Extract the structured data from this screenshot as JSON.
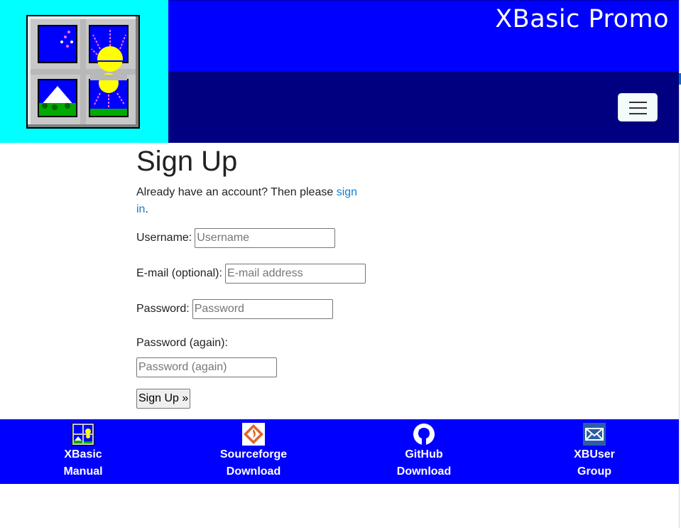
{
  "header": {
    "title": "XBasic Promo",
    "logo_icon": "xbasic-window-logo",
    "menu_icon": "hamburger-menu-icon"
  },
  "main": {
    "heading": "Sign Up",
    "intro_text": "Already have an account? Then please ",
    "signin_link": "sign in",
    "intro_end": ".",
    "username_label": "Username:",
    "username_placeholder": "Username",
    "username_value": "",
    "email_label": "E-mail (optional):",
    "email_placeholder": "E-mail address",
    "email_value": "",
    "password_label": "Password:",
    "password_placeholder": "Password",
    "password_value": "",
    "password2_label": "Password (again):",
    "password2_placeholder": "Password (again)",
    "password2_value": "",
    "submit_label": "Sign Up »"
  },
  "footer": {
    "items": [
      {
        "line1": "XBasic",
        "line2": "Manual",
        "icon": "xbasic-manual-icon"
      },
      {
        "line1": "Sourceforge",
        "line2": "Download",
        "icon": "sourceforge-icon"
      },
      {
        "line1": "GitHub",
        "line2": "Download",
        "icon": "github-icon"
      },
      {
        "line1": "XBUser",
        "line2": "Group",
        "icon": "mail-group-icon"
      }
    ]
  },
  "colors": {
    "logo_bg": "#00ffff",
    "header_top": "#0000ff",
    "header_nav": "#000080",
    "footer_bg": "#0000ff",
    "link": "#0d7fd0"
  }
}
